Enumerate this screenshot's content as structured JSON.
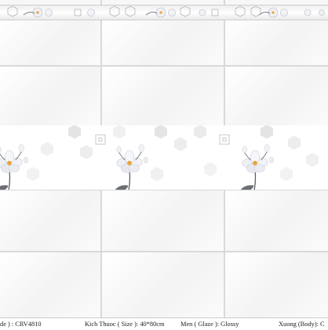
{
  "product": {
    "code_label": "de ) : CRV4810",
    "size_label": "Kich Thuoc ( Size ): 40*80cm",
    "glaze_label": "Men ( Glaze ): Glossy",
    "body_label": "Xuong (Body): C"
  },
  "colors": {
    "tile": "#f7f7f7",
    "grout": "#d9d9d9",
    "hexagon": "#e2e2e2",
    "petal": "#eef0f5",
    "flower_center": "#e8a33a",
    "leaf": "#6b6f73"
  }
}
